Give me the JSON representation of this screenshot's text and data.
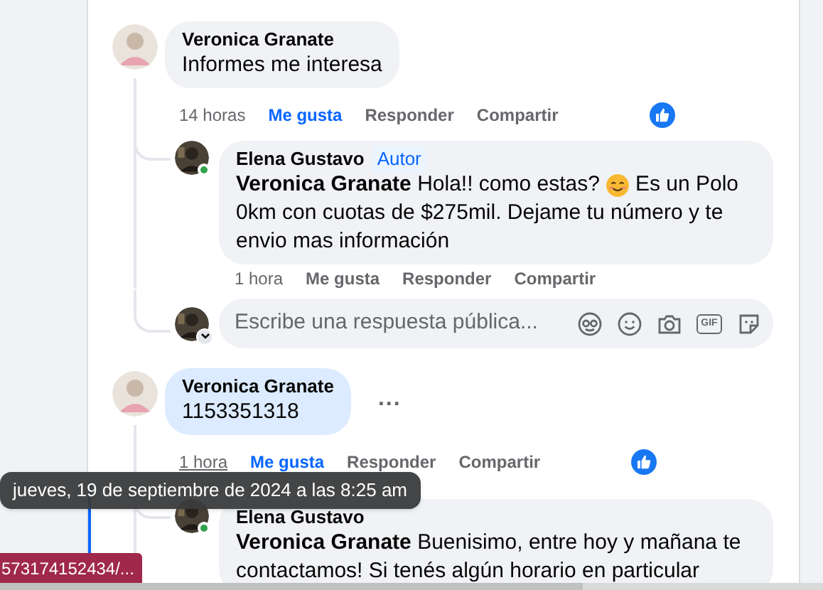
{
  "comments": [
    {
      "author": "Veronica Granate",
      "highlighted": false,
      "segments": [
        {
          "kind": "text",
          "text": "Informes me interesa"
        }
      ],
      "time": "14 horas",
      "time_hovered": false,
      "liked": true,
      "like_label": "Me gusta",
      "reply_label": "Responder",
      "share_label": "Compartir",
      "reaction": true,
      "replies": [
        {
          "author": "Elena Gustavo",
          "badge": "Autor",
          "online": true,
          "segments": [
            {
              "kind": "text",
              "text": "**Veronica Granate** Hola!! como estas?"
            },
            {
              "kind": "emoji"
            },
            {
              "kind": "text",
              "text": "Es un Polo"
            },
            {
              "kind": "text",
              "text": "0km con cuotas de $275mil. Dejame tu número y te envio mas información"
            }
          ],
          "time": "1 hora",
          "liked": false,
          "like_label": "Me gusta",
          "reply_label": "Responder",
          "share_label": "Compartir"
        }
      ],
      "reply_field": {
        "placeholder": "Escribe una respuesta pública...",
        "gif_label": "GIF"
      }
    },
    {
      "author": "Veronica Granate",
      "highlighted": true,
      "segments": [
        {
          "kind": "text",
          "text": "1153351318"
        }
      ],
      "time": "1 hora",
      "time_hovered": true,
      "liked": true,
      "like_label": "Me gusta",
      "reply_label": "Responder",
      "share_label": "Compartir",
      "reaction": true,
      "more_menu": "...",
      "replies": [
        {
          "author": "Elena Gustavo",
          "online": true,
          "segments": [
            {
              "kind": "text",
              "text": "**Veronica Granate** Buenisimo, entre hoy y mañana te contactamos! Si tenés algún horario en particular"
            }
          ]
        }
      ]
    }
  ],
  "tooltip": "jueves, 19 de septiembre de 2024 a las 8:25 am",
  "status_link": "573174152434/..."
}
